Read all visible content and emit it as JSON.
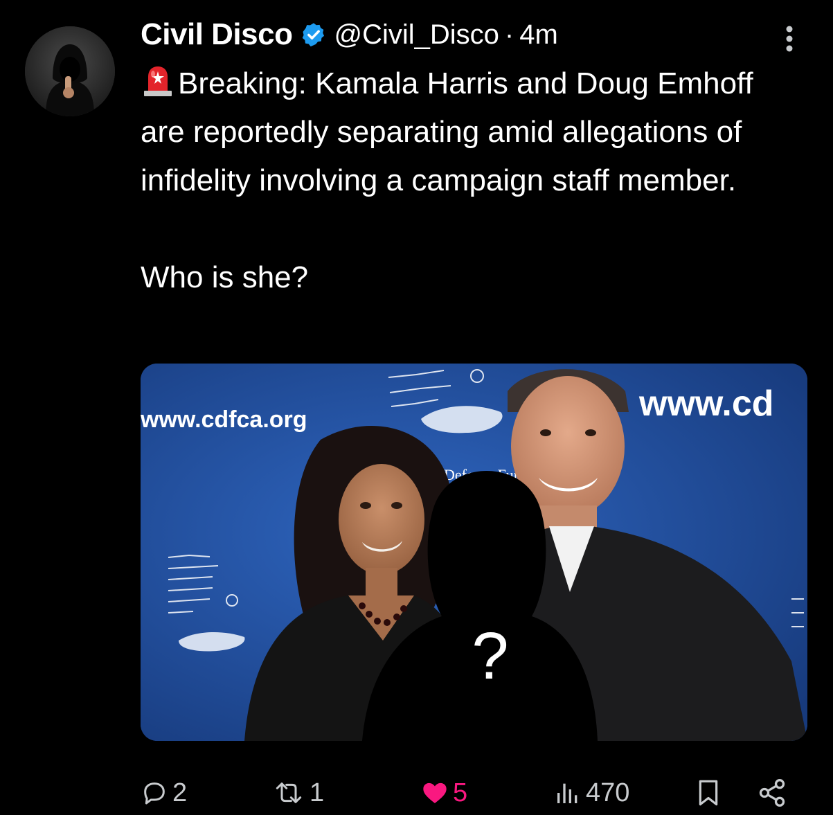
{
  "tweet": {
    "display_name": "Civil Disco",
    "handle": "@Civil_Disco",
    "separator": "·",
    "time": "4m",
    "siren_icon": "police-light-emoji",
    "text_lines": [
      "Breaking: Kamala Harris and Doug Emhoff are reportedly separating amid allegations of infidelity involving a campaign staff member."
    ],
    "question": "Who is she?"
  },
  "media": {
    "backdrop_text_left": "www.cdfca.org",
    "backdrop_text_right": "www.cd",
    "backdrop_text_center": "Defense Fund",
    "silhouette_mark": "?",
    "backdrop_color": "#1f4a96"
  },
  "actions": {
    "replies": "2",
    "reposts": "1",
    "likes": "5",
    "views": "470",
    "like_color": "#f91880",
    "verified_color": "#1d9bf0"
  }
}
